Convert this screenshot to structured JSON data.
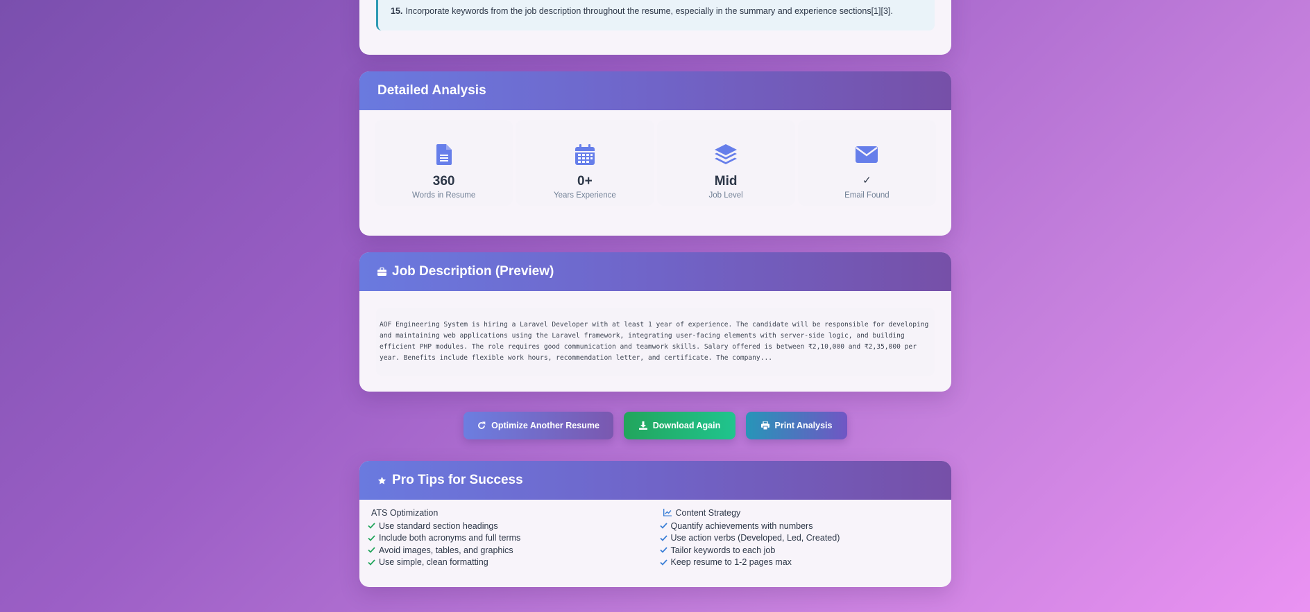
{
  "recommendation": {
    "number": "15.",
    "text": "Incorporate keywords from the job description throughout the resume, especially in the summary and experience sections[1][3]."
  },
  "analysis": {
    "title": "Detailed Analysis",
    "stats": [
      {
        "icon": "document-icon",
        "value": "360",
        "label": "Words in Resume"
      },
      {
        "icon": "calendar-icon",
        "value": "0+",
        "label": "Years Experience"
      },
      {
        "icon": "layers-icon",
        "value": "Mid",
        "label": "Job Level"
      },
      {
        "icon": "envelope-icon",
        "value": "✓",
        "label": "Email Found"
      }
    ]
  },
  "job_description": {
    "title": "Job Description (Preview)",
    "text": "AOF Engineering System is hiring a Laravel Developer with at least 1 year of experience. The candidate will be responsible for developing and maintaining web applications using the Laravel framework, integrating user-facing elements with server-side logic, and building efficient PHP modules. The role requires good communication and teamwork skills. Salary offered is between ₹2,10,000 and ₹2,35,000 per year. Benefits include flexible work hours, recommendation letter, and certificate. The company..."
  },
  "actions": {
    "optimize_label": "Optimize Another Resume",
    "download_label": "Download Again",
    "print_label": "Print Analysis"
  },
  "tips": {
    "title": "Pro Tips for Success",
    "ats": {
      "title": "ATS Optimization",
      "items": [
        "Use standard section headings",
        "Include both acronyms and full terms",
        "Avoid images, tables, and graphics",
        "Use simple, clean formatting"
      ]
    },
    "content": {
      "title": "Content Strategy",
      "items": [
        "Quantify achievements with numbers",
        "Use action verbs (Developed, Led, Created)",
        "Tailor keywords to each job",
        "Keep resume to 1-2 pages max"
      ]
    }
  },
  "colors": {
    "accent": "#667eea",
    "success": "#22a55c",
    "check_green": "#22a55c",
    "check_blue": "#3b7fd6"
  }
}
